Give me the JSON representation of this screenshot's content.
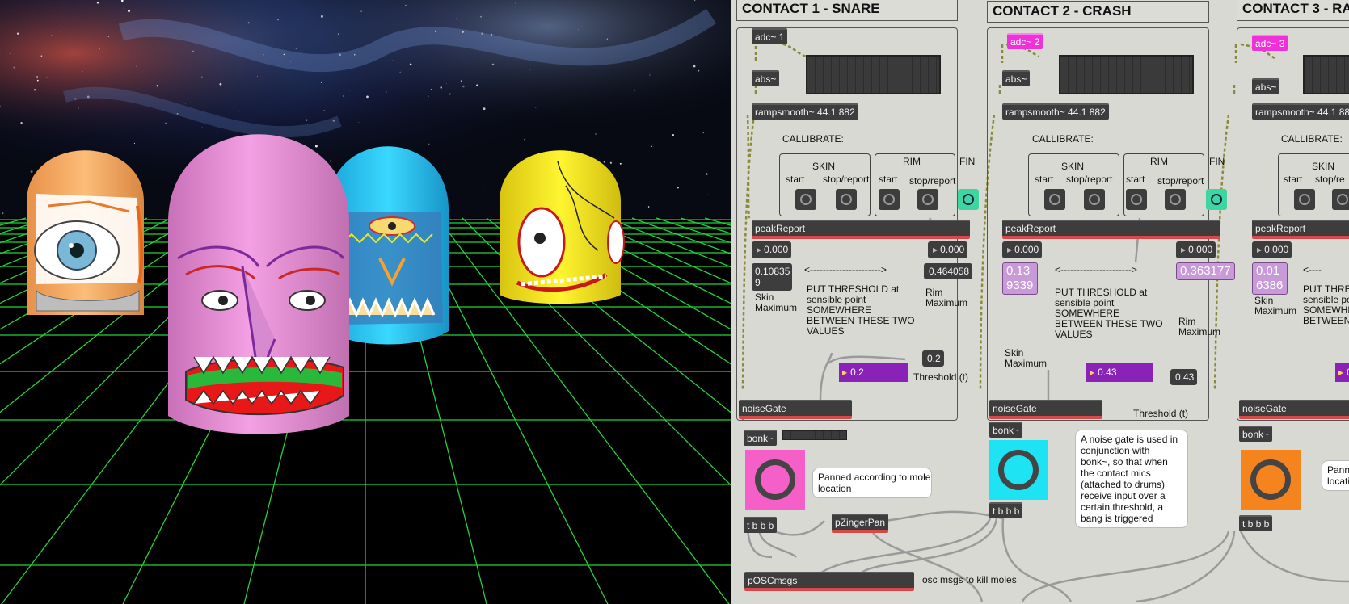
{
  "colors": {
    "grid": "#22d33a",
    "patcher_bg": "#d9d9d3",
    "object_bg": "#3d3d3d",
    "adc_highlight": "#f030d8",
    "bang_contact1": "#f45fc8",
    "bang_contact2": "#1ee3f2",
    "bang_contact3": "#f5841e",
    "threshold_number": "#8a22b8",
    "patch_cord": "#999999",
    "signal_cord": "#8a8a3c"
  },
  "game": {
    "moles": [
      {
        "name": "orange-mole",
        "color": "#f7a85a",
        "face": "one big eye, gray teeth"
      },
      {
        "name": "pink-mole",
        "color": "#e88fd8",
        "face": "beak nose, red and green grin"
      },
      {
        "name": "blue-mole",
        "color": "#22c8f0",
        "face": "single eye, zigzag teeth"
      },
      {
        "name": "yellow-mole",
        "color": "#f8ec20",
        "face": "one eye, red toothy smile"
      }
    ]
  },
  "patcher": {
    "contacts": [
      {
        "header": "CONTACT 1 - SNARE",
        "adc": "adc~ 1",
        "abs": "abs~",
        "ramp": "rampsmooth~ 44.1 882",
        "calibrate": "CALLIBRATE:",
        "skin": "SKIN",
        "rim": "RIM",
        "fin": "FIN",
        "start": "start",
        "stop": "stop/report",
        "start2": "start",
        "stop2": "stop/report",
        "peak": "peakReport",
        "num_left": "0.000",
        "num_right": "0.000",
        "skin_max": "0.10835\n9",
        "rim_max": "0.464058",
        "arrow": "<---------------------->",
        "instruction": "PUT THRESHOLD at\nsensible point\nSOMEWHERE\nBETWEEN THESE TWO\nVALUES",
        "skin_label": "Skin\nMaximum",
        "rim_label": "Rim\nMaximum",
        "threshold": "0.2",
        "threshold_msg": "0.2",
        "threshold_label": "Threshold (t)",
        "noisegate": "noiseGate",
        "bonk": "bonk~",
        "trigger": "t b b b",
        "comment": "Panned according to mole\nlocation",
        "pan": "pZingerPan",
        "osc": "pOSCmsgs",
        "osc_comment": "osc msgs to kill moles"
      },
      {
        "header": "CONTACT 2 - CRASH",
        "adc": "adc~ 2",
        "abs": "abs~",
        "ramp": "rampsmooth~ 44.1 882",
        "calibrate": "CALLIBRATE:",
        "skin": "SKIN",
        "rim": "RIM",
        "fin": "FIN",
        "start": "start",
        "stop": "stop/report",
        "start2": "start",
        "stop2": "stop/report",
        "peak": "peakReport",
        "num_left": "0.000",
        "num_right": "0.000",
        "skin_max": "0.13\n9339",
        "rim_max": "0.363177",
        "arrow": "<---------------------->",
        "instruction": "PUT THRESHOLD at\nsensible point\nSOMEWHERE\nBETWEEN THESE TWO\nVALUES",
        "skin_label": "Skin\nMaximum",
        "rim_label": "Rim\nMaximum",
        "threshold": "0.43",
        "threshold_msg": "0.43",
        "threshold_label": "Threshold (t)",
        "noisegate": "noiseGate",
        "bonk": "bonk~",
        "trigger": "t b b b",
        "comment": "A noise gate is used in\nconjunction with\nbonk~, so that when\nthe contact mics\n(attached to drums)\nreceive input over a\ncertain threshold, a\nbang is triggered"
      },
      {
        "header": "CONTACT 3 - RA",
        "adc": "adc~ 3",
        "abs": "abs~",
        "ramp": "rampsmooth~ 44.1 88",
        "calibrate": "CALLIBRATE:",
        "skin": "SKIN",
        "start": "start",
        "stop": "stop/re",
        "peak": "peakReport",
        "num_left": "0.000",
        "skin_max": "0.01\n6386",
        "arrow": "<----",
        "instruction": "PUT THRES\nsensible poi\nSOMEWHE\nBETWEEN",
        "skin_label": "Skin\nMaximum",
        "threshold": "0",
        "noisegate": "noiseGate",
        "bonk": "bonk~",
        "trigger": "t b b b",
        "comment": "Pann\nlocati"
      }
    ]
  }
}
